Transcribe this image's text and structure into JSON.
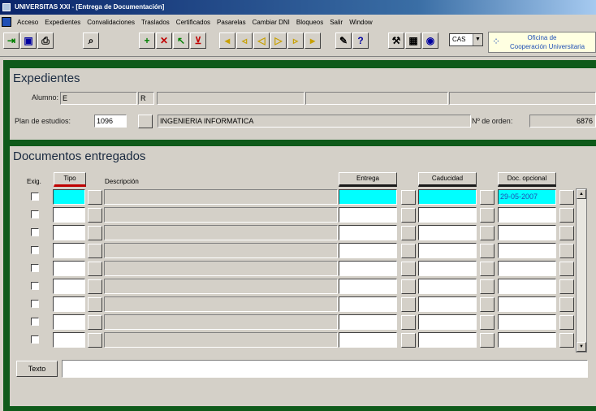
{
  "window": {
    "title": "UNIVERSITAS XXI - [Entrega de Documentación]"
  },
  "menu": [
    "Acceso",
    "Expedientes",
    "Convalidaciones",
    "Traslados",
    "Certificados",
    "Pasarelas",
    "Cambiar DNI",
    "Bloqueos",
    "Salir",
    "Window"
  ],
  "toolbar": {
    "select_value": "CAS",
    "oficina_line1": "Oficina de",
    "oficina_line2": "Cooperación Universitaria"
  },
  "expedientes": {
    "title": "Expedientes",
    "alumno_label": "Alumno:",
    "alumno_value1": "E",
    "alumno_value2": "R",
    "plan_label": "Plan de estudios:",
    "plan_code": "1096",
    "plan_name": "INGENIERIA INFORMATICA",
    "orden_label": "Nº de orden:",
    "orden_value": "6876"
  },
  "documentos": {
    "title": "Documentos entregados",
    "col_exig": "Exig.",
    "col_tipo": "Tipo",
    "col_descripcion": "Descripción",
    "col_entrega": "Entrega",
    "col_caducidad": "Caducidad",
    "col_doc_opcional": "Doc. opcional",
    "first_row_doc_opcional": "29-05-2007",
    "texto_button": "Texto"
  }
}
